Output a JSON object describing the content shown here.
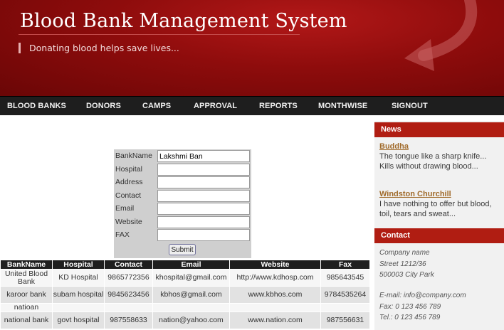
{
  "header": {
    "title": "Blood Bank Management System",
    "tagline": "Donating blood helps save lives...",
    "brand_color": "#8e0c0c"
  },
  "nav": {
    "items": [
      "BLOOD BANKS",
      "DONORS",
      "CAMPS",
      "APPROVAL",
      "REPORTS",
      "MONTHWISE",
      "SIGNOUT"
    ]
  },
  "form": {
    "fields": [
      {
        "label": "BankName",
        "value": "Lakshmi Ban"
      },
      {
        "label": "Hospital",
        "value": ""
      },
      {
        "label": "Address",
        "value": ""
      },
      {
        "label": "Contact",
        "value": ""
      },
      {
        "label": "Email",
        "value": ""
      },
      {
        "label": "Website",
        "value": ""
      },
      {
        "label": "FAX",
        "value": ""
      }
    ],
    "submit_label": "Submit"
  },
  "table": {
    "headers": [
      "BankName",
      "Hospital",
      "Contact",
      "Email",
      "Website",
      "Fax"
    ],
    "rows": [
      [
        "United Blood Bank",
        "KD Hospital",
        "9865772356",
        "khospital@gmail.com",
        "http://www.kdhosp.com",
        "985643545"
      ],
      [
        "karoor bank",
        "subam hospital",
        "9845623456",
        "kbhos@gmail.com",
        "www.kbhos.com",
        "9784535264"
      ],
      [
        "natioan",
        "",
        "",
        "",
        "",
        ""
      ],
      [
        "national bank",
        "govt hospital",
        "987558633",
        "nation@yahoo.com",
        "www.nation.com",
        "987556631"
      ]
    ]
  },
  "sidebar": {
    "news_title": "News",
    "news": [
      {
        "author": "Buddha",
        "quote": "The tongue like a sharp knife... Kills without drawing blood..."
      },
      {
        "author": "Windston Churchill",
        "quote": "I have nothing to offer but blood, toil, tears and sweat..."
      }
    ],
    "contact_title": "Contact",
    "contact_lines": [
      "Company name",
      "Street 1212/36",
      "500003 City Park",
      "E-mail: info@company.com",
      "Fax: 0 123 456 789",
      "Tel.: 0 123 456 789"
    ],
    "accent_color": "#b01d12"
  }
}
